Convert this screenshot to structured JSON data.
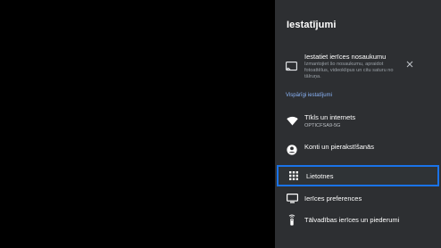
{
  "panel": {
    "title": "Iestatījumi"
  },
  "notice": {
    "icon": "cast-icon",
    "title": "Iestatiet ierīces nosaukumu",
    "description": "Izmantojiet šo nosaukumu, apraidot fotoattēlus, videoklipus un citu saturu no tālruņa.",
    "close_icon": "close-icon"
  },
  "section": {
    "header": "Vispārīgi iestatījumi"
  },
  "items": [
    {
      "icon": "wifi-icon",
      "label": "Tīkls un internets",
      "sub": "OPTICFSA9-5G"
    },
    {
      "icon": "account-icon",
      "label": "Konti un pierakstīšanās"
    },
    {
      "icon": "apps-grid-icon",
      "label": "Lietotnes",
      "focused": true
    },
    {
      "icon": "tv-icon",
      "label": "Ierīces preferences"
    },
    {
      "icon": "remote-icon",
      "label": "Tālvadības ierīces un piederumi"
    }
  ],
  "colors": {
    "panel_bg": "#2d2f32",
    "focus_border": "#1a73e8",
    "section_header": "#8ab4f8"
  }
}
